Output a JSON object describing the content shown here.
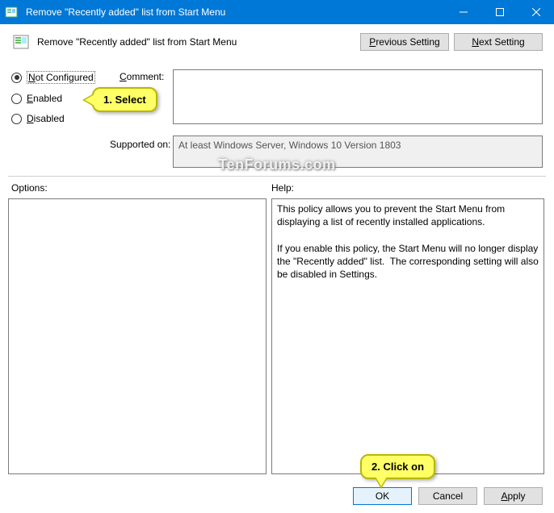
{
  "window": {
    "title": "Remove \"Recently added\" list from Start Menu"
  },
  "header": {
    "title": "Remove \"Recently added\" list from Start Menu",
    "prev_p": "P",
    "prev_rest": "revious Setting",
    "next_n": "N",
    "next_rest": "ext Setting"
  },
  "state": {
    "not_configured_n": "N",
    "not_configured_rest": "ot Configured",
    "enabled_e": "E",
    "enabled_rest": "nabled",
    "disabled_d": "D",
    "disabled_rest": "isabled"
  },
  "labels": {
    "comment_c": "C",
    "comment_rest": "omment:",
    "supported": "Supported on:",
    "options": "Options:",
    "help": "Help:"
  },
  "supported_text": "At least Windows Server, Windows 10 Version 1803",
  "help_text": "This policy allows you to prevent the Start Menu from displaying a list of recently installed applications.\n\nIf you enable this policy, the Start Menu will no longer display the \"Recently added\" list.  The corresponding setting will also be disabled in Settings.",
  "buttons": {
    "ok": "OK",
    "cancel": "Cancel",
    "apply_a": "A",
    "apply_rest": "pply"
  },
  "annotations": {
    "select": "1. Select",
    "click": "2. Click on"
  },
  "watermark": "TenForums.com"
}
